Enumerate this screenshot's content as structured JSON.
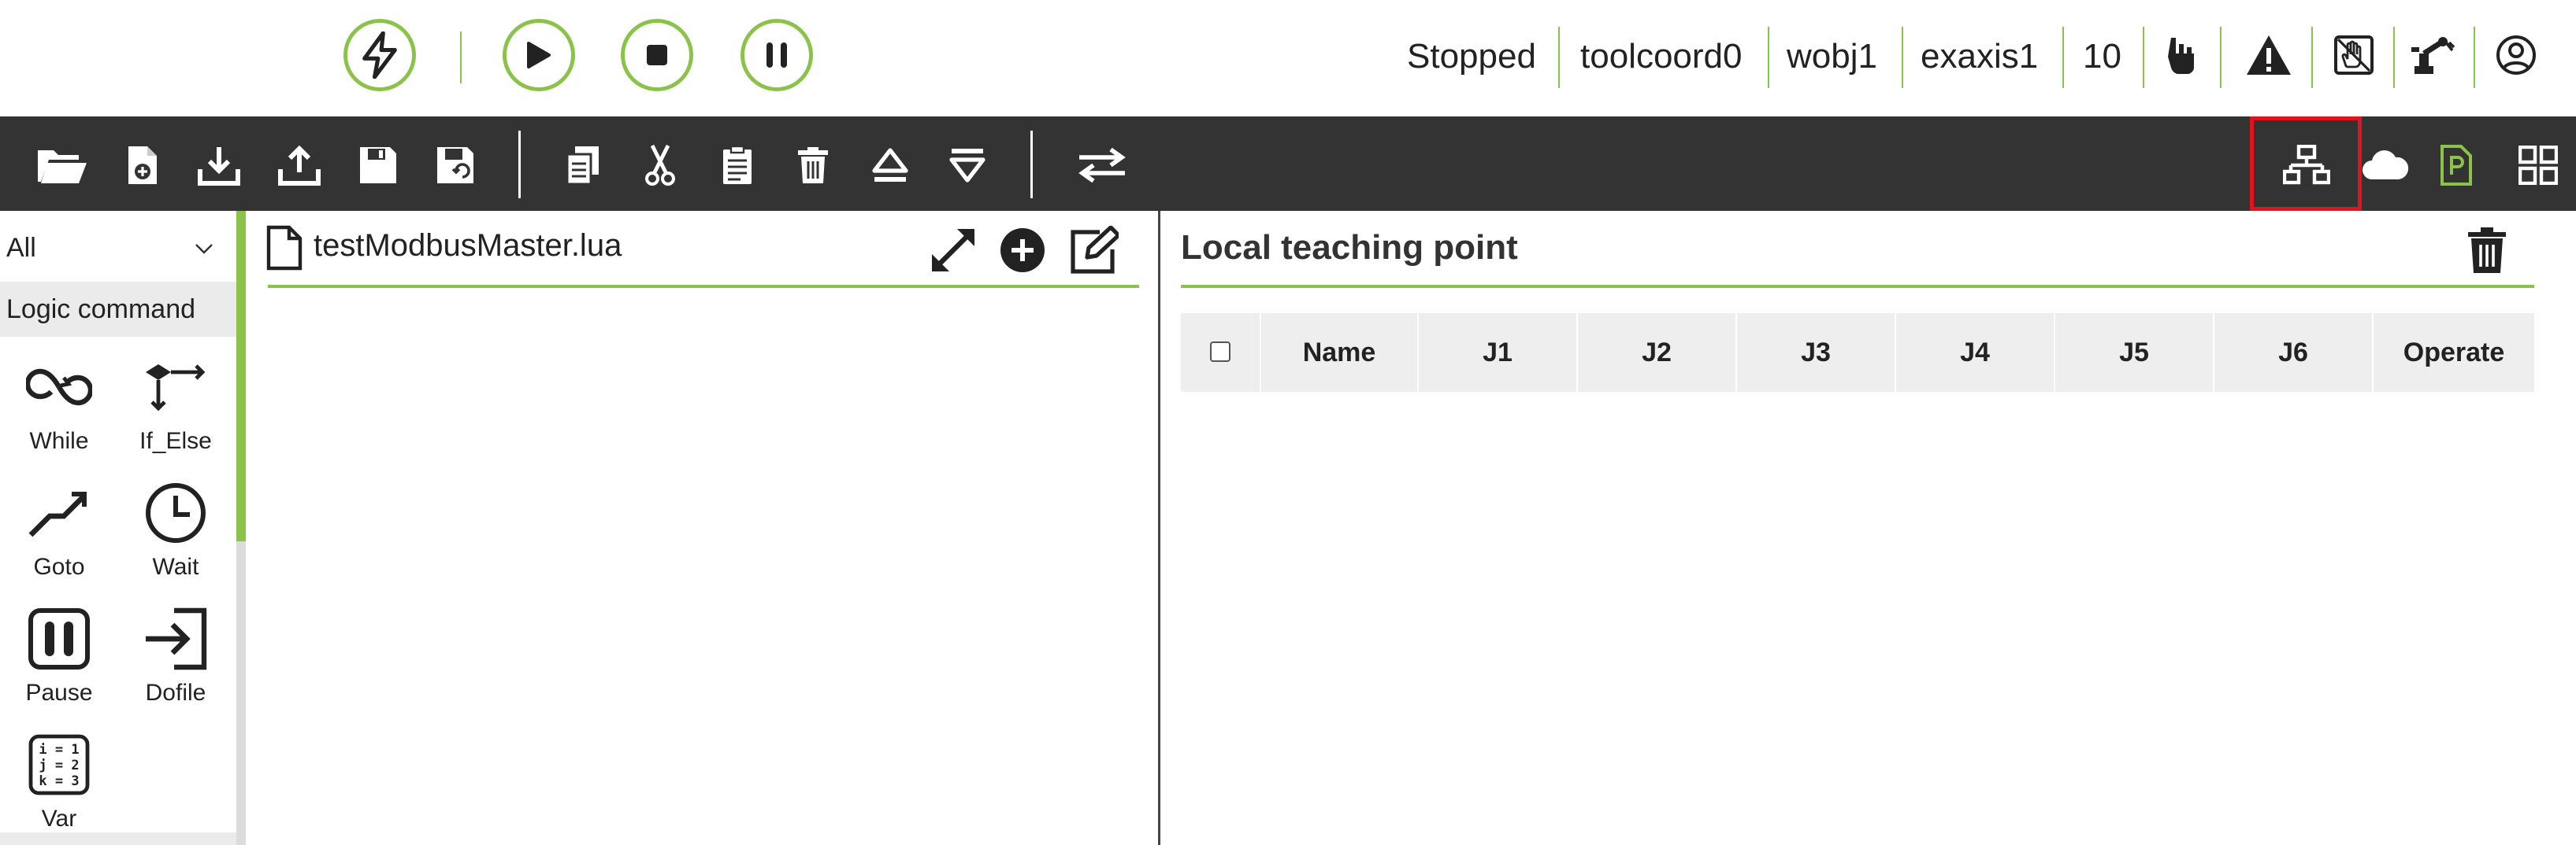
{
  "topbar": {
    "controls": [
      {
        "name": "enable",
        "icon": "lightning-icon"
      },
      {
        "name": "start",
        "icon": "play-icon"
      },
      {
        "name": "stop",
        "icon": "stop-icon"
      },
      {
        "name": "pause",
        "icon": "pause-icon"
      }
    ],
    "status": {
      "state": "Stopped",
      "tool_coord": "toolcoord0",
      "work_obj": "wobj1",
      "ext_axis": "exaxis1",
      "speed": "10"
    },
    "icons": [
      "hand-pointer-icon",
      "warning-icon",
      "drag-mode-icon",
      "robot-arm-icon",
      "user-account-icon"
    ],
    "accent_color": "#8bc34a"
  },
  "toolbar": {
    "file_icons": [
      "open-folder-icon",
      "new-file-icon",
      "download-icon",
      "upload-icon",
      "save-icon",
      "save-as-icon"
    ],
    "edit_icons": [
      "copy-icon",
      "cut-icon",
      "paste-icon",
      "delete-icon",
      "insert-above-icon",
      "insert-below-icon"
    ],
    "mode_icons": [
      "switch-icon"
    ],
    "right_icons": [
      "network-icon",
      "cloud-icon",
      "program-file-icon",
      "grid-view-icon"
    ],
    "highlighted": "network-icon",
    "highlight_color": "#e0141e",
    "background": "#333333"
  },
  "palette": {
    "filter_value": "All",
    "category": "Logic command",
    "commands": [
      {
        "label": "While",
        "icon": "loop-icon"
      },
      {
        "label": "If_Else",
        "icon": "branch-icon"
      },
      {
        "label": "Goto",
        "icon": "goto-icon"
      },
      {
        "label": "Wait",
        "icon": "clock-icon"
      },
      {
        "label": "Pause",
        "icon": "pause-box-icon"
      },
      {
        "label": "Dofile",
        "icon": "dofile-icon"
      },
      {
        "label": "Var",
        "icon": "variable-icon"
      }
    ],
    "var_icon_lines": [
      "i = 1",
      "j = 2",
      "k = 3"
    ]
  },
  "editor": {
    "file_name": "testModbusMaster.lua"
  },
  "teach": {
    "title": "Local teaching point",
    "columns": [
      "Name",
      "J1",
      "J2",
      "J3",
      "J4",
      "J5",
      "J6",
      "Operate"
    ]
  }
}
